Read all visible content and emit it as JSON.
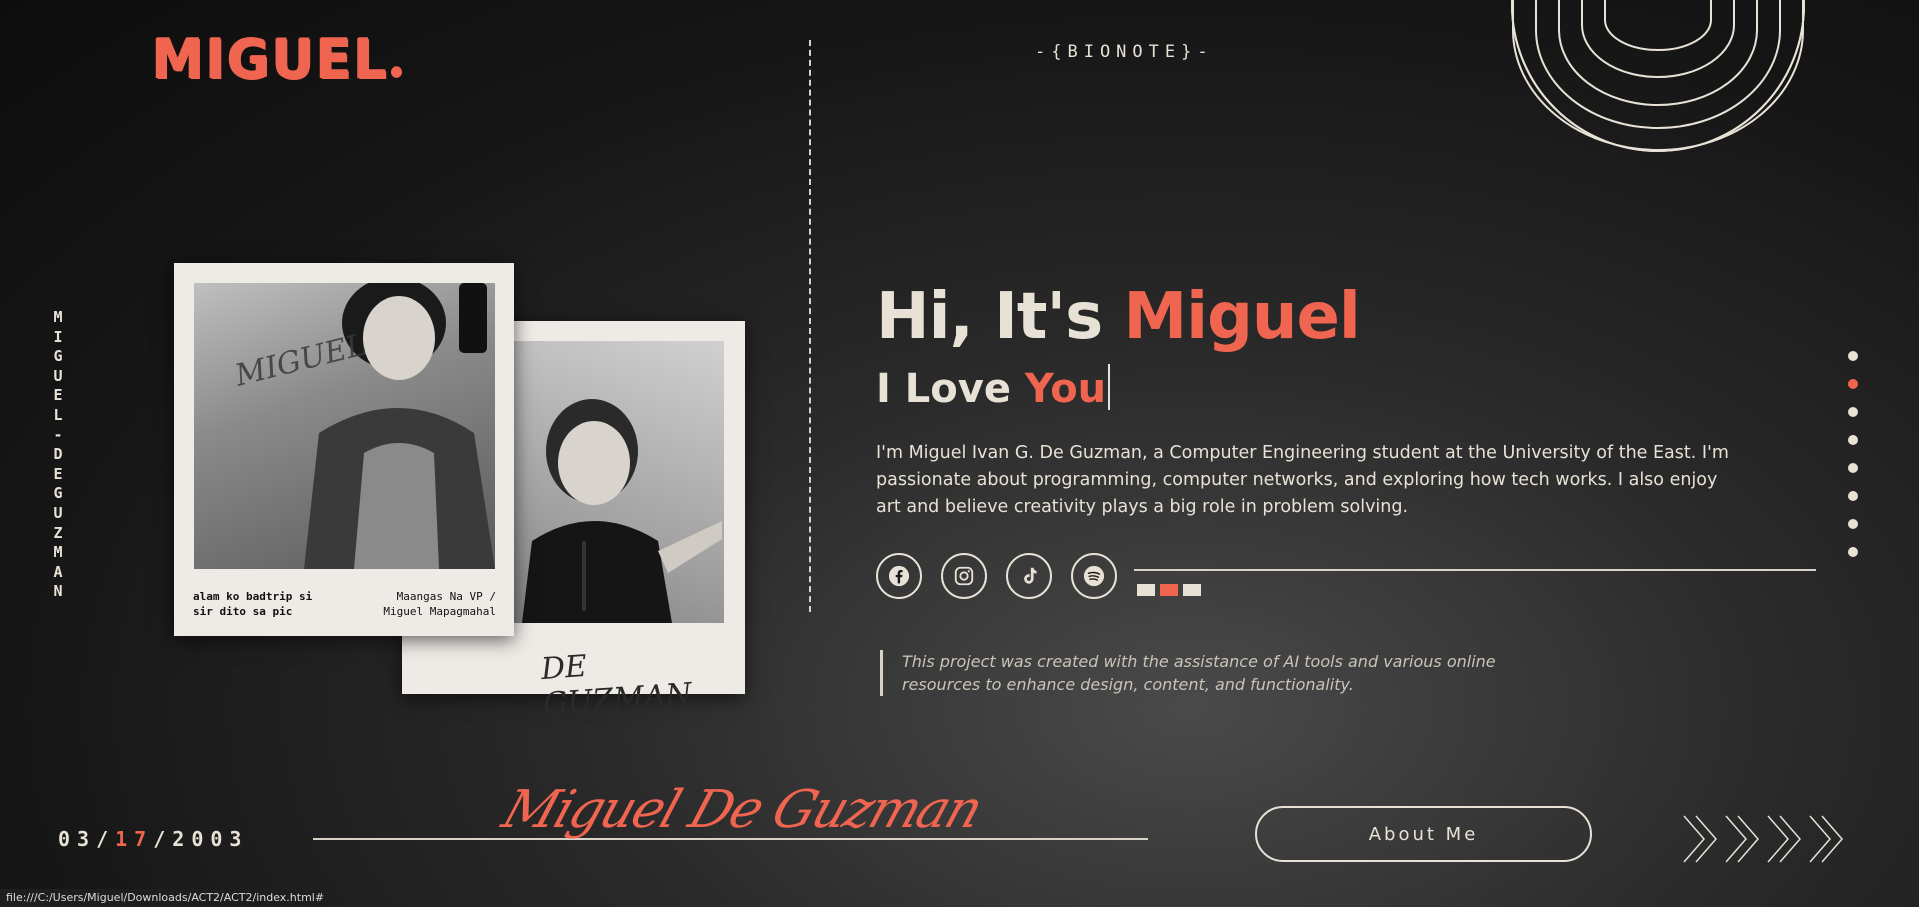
{
  "logo": "MIGUEL",
  "section_tag": "-{BIONOTE}-",
  "vertical_name": "MIGUEL-DEGUZMAN",
  "polaroid1": {
    "signature": "MIGUEL",
    "caption_left": "alam ko badtrip si\nsir dito sa pic",
    "caption_right": "Maangas Na VP /\nMiguel Mapagmahal"
  },
  "polaroid2": {
    "signature": "DE GUZMAN"
  },
  "hero": {
    "greet": "Hi, It's ",
    "name": "Miguel",
    "love": "I Love ",
    "love_accent": "You"
  },
  "bio": "I'm Miguel Ivan G. De Guzman, a Computer Engineering student at the University of the East. I'm passionate about programming, computer networks, and exploring how tech works. I also enjoy art and believe creativity plays a big role in problem solving.",
  "socials": [
    {
      "name": "facebook-icon"
    },
    {
      "name": "instagram-icon"
    },
    {
      "name": "tiktok-icon"
    },
    {
      "name": "spotify-icon"
    }
  ],
  "indicator_squares": [
    false,
    true,
    false
  ],
  "note": "This project was created with the assistance of AI tools and various online resources to enhance design, content, and functionality.",
  "side_nav": {
    "count": 8,
    "active_index": 1
  },
  "footer": {
    "date_month": "03",
    "date_sep1": "/",
    "date_day": "17",
    "date_sep2": "/",
    "date_year": "2003",
    "script_name": "Miguel De Guzman",
    "about_label": "About Me"
  },
  "status_url": "file:///C:/Users/Miguel/Downloads/ACT2/ACT2/index.html#",
  "colors": {
    "accent": "#f06550",
    "cream": "#e8e2d6",
    "bg": "#1a1a1a"
  }
}
